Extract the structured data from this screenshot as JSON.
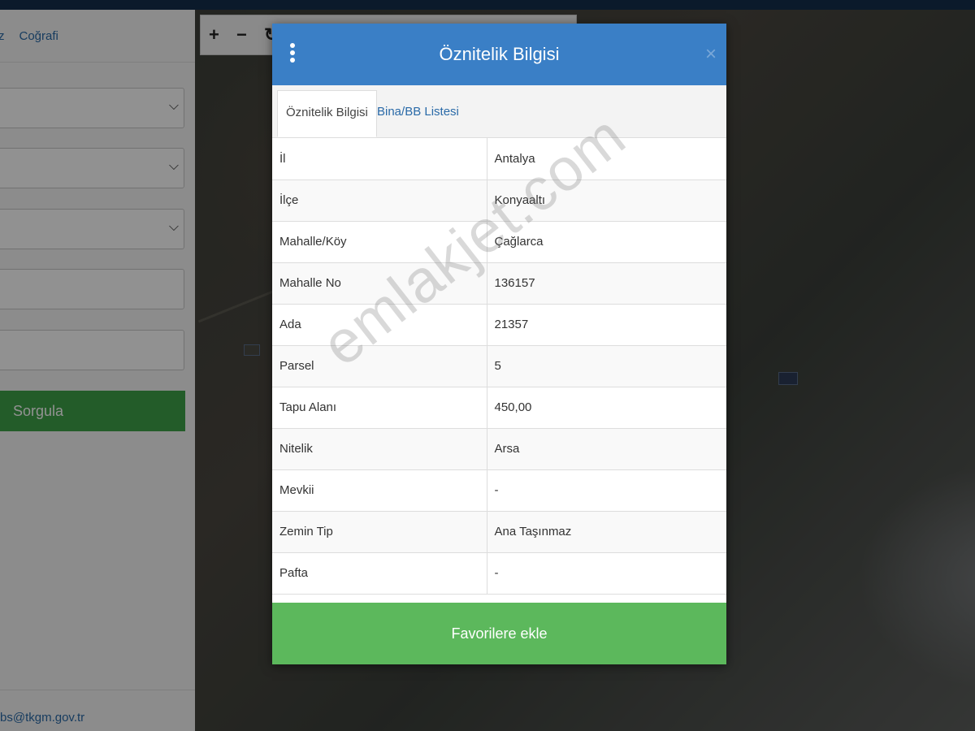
{
  "sidebar": {
    "tabs": [
      "z",
      "Coğrafi"
    ],
    "query_button": "Sorgula",
    "footer_email": "bs@tkgm.gov.tr"
  },
  "map_controls": {
    "zoom_in": "+",
    "zoom_out": "−",
    "refresh": "↻"
  },
  "modal": {
    "title": "Öznitelik Bilgisi",
    "close": "×",
    "tabs": [
      "Öznitelik Bilgisi",
      "Bina/BB Listesi"
    ],
    "rows": [
      {
        "key": "İl",
        "value": "Antalya"
      },
      {
        "key": "İlçe",
        "value": "Konyaaltı"
      },
      {
        "key": "Mahalle/Köy",
        "value": "Çağlarca"
      },
      {
        "key": "Mahalle No",
        "value": "136157"
      },
      {
        "key": "Ada",
        "value": "21357"
      },
      {
        "key": "Parsel",
        "value": "5"
      },
      {
        "key": "Tapu Alanı",
        "value": "450,00"
      },
      {
        "key": "Nitelik",
        "value": "Arsa"
      },
      {
        "key": "Mevkii",
        "value": "-"
      },
      {
        "key": "Zemin Tip",
        "value": "Ana Taşınmaz"
      },
      {
        "key": "Pafta",
        "value": "-"
      }
    ],
    "favorite_button": "Favorilere ekle"
  },
  "watermark": "emlakjet.com",
  "colors": {
    "header_blue": "#3a7fc6",
    "favorite_green": "#5cb85c",
    "query_green": "#3fa349",
    "link_blue": "#2a6aa8"
  }
}
